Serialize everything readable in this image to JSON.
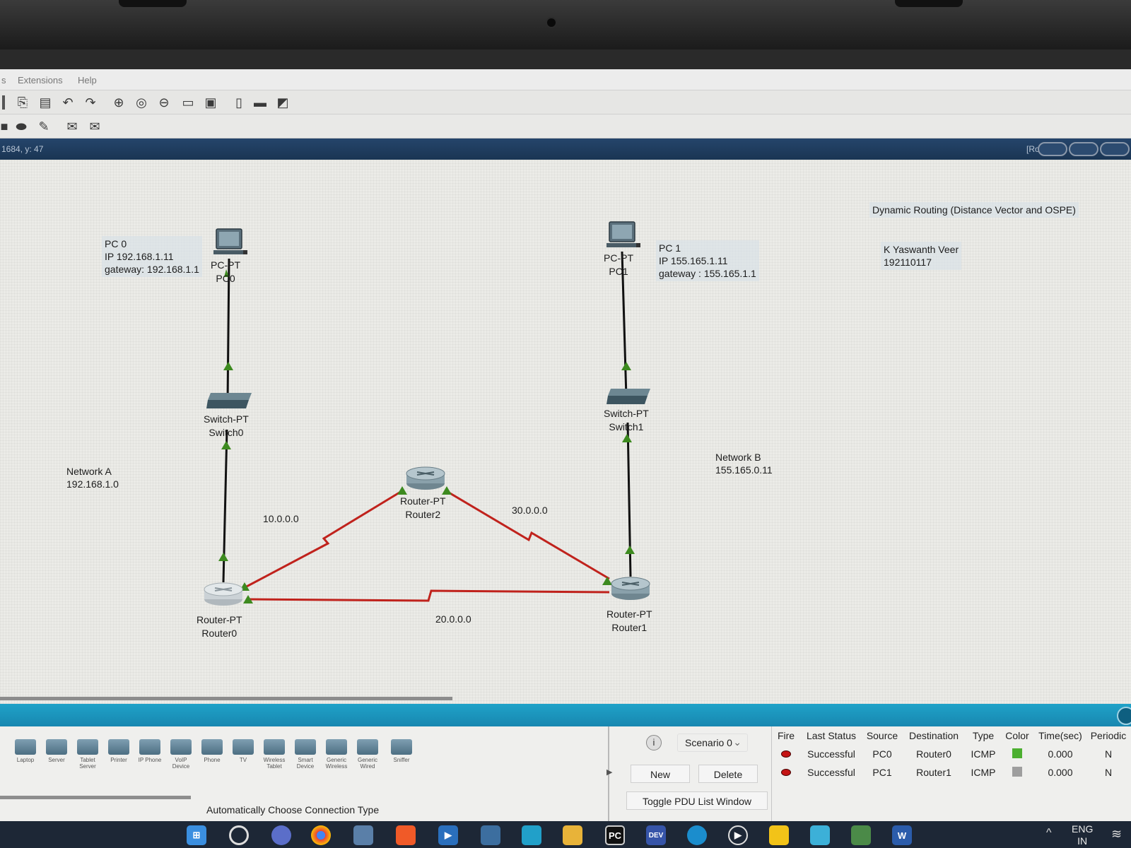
{
  "menu": {
    "items": [
      "s",
      "Extensions",
      "Help"
    ]
  },
  "toolbar": {
    "row1_icons": [
      "copy-icon",
      "paste-icon",
      "undo-icon",
      "redo-icon",
      "zoom-in-icon",
      "zoom-reset-icon",
      "zoom-out-icon",
      "drawing-palette-icon",
      "custom-device-icon",
      "notes-icon",
      "cluster-icon",
      "screenshot-icon"
    ],
    "row2_icons": [
      "select-icon",
      "shape-icon",
      "inspect-icon",
      "add-simple-pdu-icon",
      "add-complex-pdu-icon"
    ]
  },
  "status": {
    "coords": "1684, y: 47",
    "root": "[Root]"
  },
  "topology": {
    "notes": {
      "pc0": "PC 0\nIP 192.168.1.11\ngateway: 192.168.1.1",
      "pc1": "PC 1\nIP 155.165.1.11\ngateway : 155.165.1.1",
      "title": "Dynamic Routing (Distance Vector and OSPE)",
      "author": "K Yaswanth Veer\n192110117",
      "network_a": "Network A\n192.168.1.0",
      "network_b": "Network B\n155.165.0.11"
    },
    "devices": {
      "pc0": "PC-PT\nPC0",
      "pc1": "PC-PT\nPC1",
      "switch0": "Switch-PT\nSwitch0",
      "switch1": "Switch-PT\nSwitch1",
      "router0": "Router-PT\nRouter0",
      "router1": "Router-PT\nRouter1",
      "router2": "Router-PT\nRouter2"
    },
    "links": {
      "r0_r2": "10.0.0.0",
      "r0_r1": "20.0.0.0",
      "r2_r1": "30.0.0.0"
    },
    "colors": {
      "serial": "#c0221c",
      "ethernet": "#111111",
      "port_up": "#3d8a1f"
    }
  },
  "device_panel": {
    "tiles": [
      "Laptop",
      "Server",
      "Tablet Server",
      "Printer",
      "IP Phone",
      "VoIP Device",
      "Phone",
      "TV",
      "Wireless Tablet",
      "Smart Device",
      "Generic Wireless",
      "Generic Wired",
      "Sniffer"
    ],
    "connection_type": "Automatically Choose Connection Type"
  },
  "scenario": {
    "info": "i",
    "selected": "Scenario 0",
    "new_label": "New",
    "delete_label": "Delete",
    "toggle_label": "Toggle PDU List Window"
  },
  "pdu_list": {
    "columns": [
      "Fire",
      "Last Status",
      "Source",
      "Destination",
      "Type",
      "Color",
      "Time(sec)",
      "Periodic"
    ],
    "rows": [
      {
        "last_status": "Successful",
        "source": "PC0",
        "destination": "Router0",
        "type": "ICMP",
        "color": "#4caf30",
        "time": "0.000",
        "periodic": "N"
      },
      {
        "last_status": "Successful",
        "source": "PC1",
        "destination": "Router1",
        "type": "ICMP",
        "color": "#9e9e9e",
        "time": "0.000",
        "periodic": "N"
      }
    ]
  },
  "taskbar": {
    "apps": [
      "windows-start-icon",
      "search-icon",
      "teams-icon",
      "chrome-icon",
      "store-icon",
      "brave-icon",
      "media-icon",
      "python-icon",
      "desktop-icon",
      "file-explorer-icon",
      "pycharm-icon",
      "devcpp-icon",
      "edge-icon",
      "media-player-icon",
      "sticky-notes-icon",
      "photos-icon",
      "packet-tracer-icon",
      "word-icon"
    ],
    "pycharm_label": "PC",
    "devcpp_label": "DEV",
    "word_label": "W",
    "lang_line1": "ENG",
    "lang_line2": "IN"
  }
}
